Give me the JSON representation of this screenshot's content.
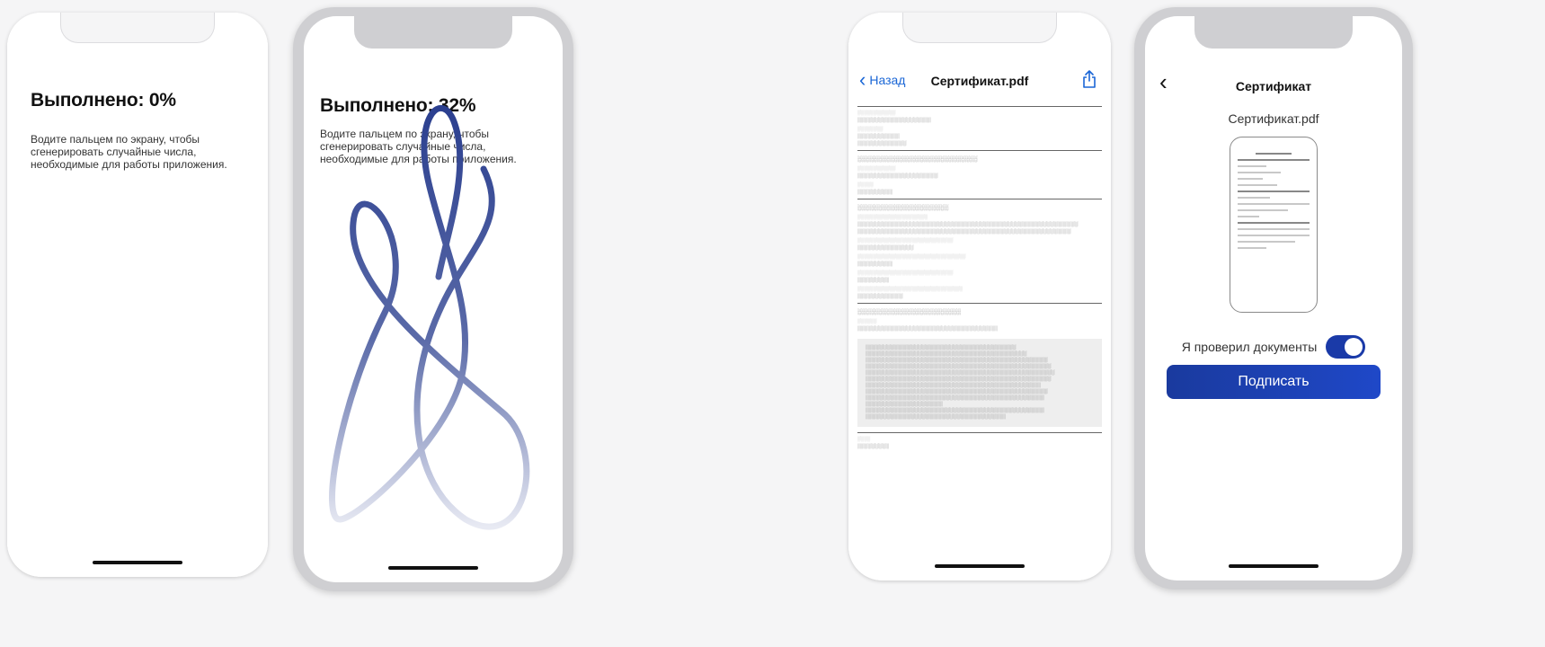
{
  "screen1": {
    "title": "Выполнено: 0%",
    "instruction": "Водите пальцем по экрану, чтобы сгенерировать случайные числа, необходимые для работы приложения."
  },
  "screen2": {
    "title": "Выполнено: 32%",
    "instruction": "Водите пальцем по экрану, чтобы сгенерировать случайные числа, необходимые для работы приложения.",
    "stroke_color": "#2b3f8f"
  },
  "pdf_viewer": {
    "back_label": "Назад",
    "title": "Сертификат.pdf",
    "share_icon": "share-icon",
    "accent_color": "#1a66d6"
  },
  "sign_screen": {
    "title": "Сертификат",
    "file_name": "Сертификат.pdf",
    "checkbox_label": "Я проверил документы",
    "toggle_on": true,
    "sign_button": "Подписать",
    "button_color": "#1a3aa8"
  }
}
